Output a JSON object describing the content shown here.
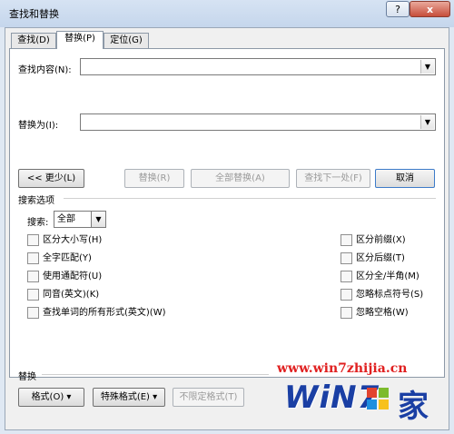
{
  "window": {
    "title": "查找和替换",
    "help_label": "?",
    "close_label": "x"
  },
  "tabs": [
    {
      "label": "查找(D)",
      "active": false
    },
    {
      "label": "替换(P)",
      "active": true
    },
    {
      "label": "定位(G)",
      "active": false
    }
  ],
  "find": {
    "label": "查找内容(N):",
    "value": ""
  },
  "replace": {
    "label": "替换为(I):",
    "value": ""
  },
  "buttons": {
    "less": "<< 更少(L)",
    "replace": "替换(R)",
    "replace_all": "全部替换(A)",
    "find_next": "查找下一处(F)",
    "cancel": "取消"
  },
  "search_options": {
    "heading": "搜索选项",
    "search_label": "搜索:",
    "search_value": "全部",
    "left_options": [
      "区分大小写(H)",
      "全字匹配(Y)",
      "使用通配符(U)",
      "同音(英文)(K)",
      "查找单词的所有形式(英文)(W)"
    ],
    "right_options": [
      "区分前缀(X)",
      "区分后缀(T)",
      "区分全/半角(M)",
      "忽略标点符号(S)",
      "忽略空格(W)"
    ]
  },
  "replace_section": {
    "heading": "替换",
    "format_label": "格式(O) ▾",
    "special_label": "特殊格式(E) ▾",
    "no_format_label": "不限定格式(T)"
  },
  "watermark": {
    "url": "www.win7zhijia.cn",
    "logo_text": "WiN7",
    "logo_cn": "家"
  },
  "colors": {
    "watermark_red": "#e02020",
    "logo_blue": "#1a3fa4"
  }
}
